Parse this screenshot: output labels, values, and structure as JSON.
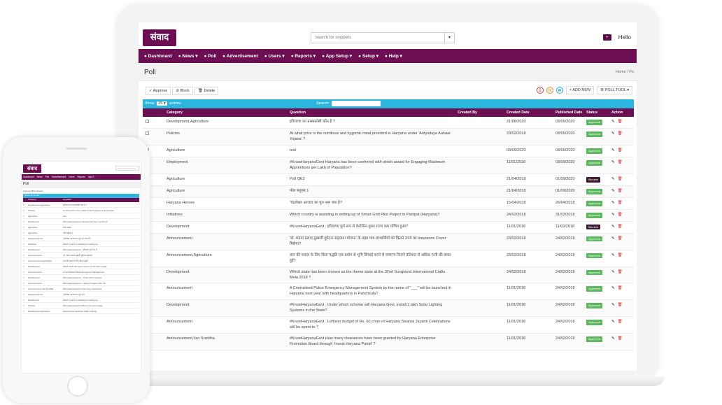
{
  "app": {
    "logo_text": "संवाद",
    "hello_label": "Hello",
    "plus_icon": "+"
  },
  "search": {
    "placeholder": "Search for snippets",
    "button": "▾"
  },
  "nav": [
    {
      "label": "Dashboard",
      "icon": "home-icon"
    },
    {
      "label": "News",
      "icon": "newspaper-icon"
    },
    {
      "label": "Poll",
      "icon": "question-icon"
    },
    {
      "label": "Advertisement",
      "icon": "image-icon"
    },
    {
      "label": "Users",
      "icon": "users-icon"
    },
    {
      "label": "Reports",
      "icon": "file-icon"
    },
    {
      "label": "App Setup",
      "icon": "gear-icon"
    },
    {
      "label": "Setup",
      "icon": "gear-icon"
    },
    {
      "label": "Help",
      "icon": "help-icon"
    }
  ],
  "page": {
    "title": "Poll",
    "breadcrumb_home": "Home",
    "breadcrumb_current": "Po"
  },
  "toolbar": {
    "approve": "Approve",
    "block": "Block",
    "delete": "Delete",
    "add_new": "+ ADD NEW",
    "poll_tool": "POLL TOOL"
  },
  "filter": {
    "show_label": "Show",
    "entries_value": "25",
    "entries_label": "entries",
    "search_label": "Search:"
  },
  "table": {
    "headers": [
      "",
      "Category",
      "Question",
      "Created By",
      "Created Date",
      "Published Date",
      "Status",
      "Action"
    ],
    "rows": [
      {
        "category": "Development,Agriculture",
        "question": "हरियाणा का प्रथमकोष्ठी कौन है ?",
        "created_by": "",
        "created": "21/08/2020",
        "published": "03/09/2020",
        "status": "Approved"
      },
      {
        "category": "Policies",
        "question": "At what price is the nutritious and hygienic meal provided in Haryana under 'Antyodaya Aahaar Yojana' ?",
        "created_by": "",
        "created": "23/02/2018",
        "published": "03/09/2020",
        "status": "Approved"
      },
      {
        "category": "Agriculture",
        "question": "test",
        "created_by": "",
        "created": "03/09/2020",
        "published": "03/09/2020",
        "status": "Approved"
      },
      {
        "category": "Employment",
        "question": "#KnowHaryanaGovt Haryana has been conferred with which award for Engaging Maximum Apprentices per Lakh of Population?",
        "created_by": "",
        "created": "11/01/2018",
        "published": "03/09/2020",
        "status": "Approved"
      },
      {
        "category": "Agriculture",
        "question": "Poll QE2",
        "created_by": "",
        "created": "21/04/2018",
        "published": "01/09/2020",
        "status": "Blocked"
      },
      {
        "category": "Agriculture",
        "question": "पोल क्यूएस 1",
        "created_by": "",
        "created": "21/04/2018",
        "published": "01/09/2020",
        "status": "Approved"
      },
      {
        "category": "Haryana Heroes",
        "question": "'चंद्रशेखर आजाद का पूरा नाम क्या है?",
        "created_by": "",
        "created": "15/04/2018",
        "published": "26/04/2018",
        "status": "Approved"
      },
      {
        "category": "Initiatives",
        "question": "Which country is assisting in setting up of Smart Grid Pilot Project in Panipat (Haryana)?",
        "created_by": "",
        "created": "24/02/2018",
        "published": "31/03/2018",
        "status": "Approved"
      },
      {
        "category": "Development",
        "question": "#KnowHaryanaGovt : हरियाणा पूर्ण रूप से केरोसिन मुक्त राज्य कब घोषित हुआ?",
        "created_by": "",
        "created": "11/01/2018",
        "published": "11/03/2018",
        "status": "Blocked"
      },
      {
        "category": "Announcement",
        "question": "'डॉ. श्यामा प्रसाद मुखर्जी दुर्घटना सहायता योजना' के तहत पात्र लाभार्थियों को कितने रुपये का Insurance Cover मिलेगा?",
        "created_by": "",
        "created": "23/02/2018",
        "published": "24/02/2018",
        "status": "Approved"
      },
      {
        "category": "Announcement,Agriculture",
        "question": "धान की फसल के लिए किस पद्धति एक प्रयोग से भूमि सिंचाई करने से सामान्य कितने प्रतिशत से अधिक पानी की बचत हुई?",
        "created_by": "",
        "created": "23/02/2018",
        "published": "24/02/2018",
        "status": "Approved"
      },
      {
        "category": "Development",
        "question": "Which state has been chosen as the theme state at the 32nd Surajkund International Crafts Mela 2018 ?",
        "created_by": "",
        "created": "24/02/2018",
        "published": "24/02/2018",
        "status": "Approved"
      },
      {
        "category": "Announcement",
        "question": "A Centralised Police Emergency Management System by the name of \"___\" will be launched in Haryana next year with headquarters in Panchkula?",
        "created_by": "",
        "created": "11/01/2018",
        "published": "24/02/2018",
        "status": "Approved"
      },
      {
        "category": "Development",
        "question": "#KnowHaryanaGovt : Under which scheme will Haryana Govt. install 1 lakh Solar Lighting Systems in the State?",
        "created_by": "",
        "created": "11/01/2018",
        "published": "24/02/2018",
        "status": "Approved"
      },
      {
        "category": "Announcement",
        "question": "#KnowHaryanaGovt : Leftover budget of Rs. 60 crore of Haryana Swarna Jayanti Celebrations will be spent to ?",
        "created_by": "",
        "created": "11/01/2018",
        "published": "24/02/2018",
        "status": "Approved"
      },
      {
        "category": "Announcement,Jan Suvidha",
        "question": "#KnowHaryanaGovt How many clearances have been granted by Haryana Enterprise Promotion Board through 'Invest Haryana Portal' ?",
        "created_by": "",
        "created": "11/01/2018",
        "published": "24/02/2018",
        "status": "Approved"
      }
    ]
  },
  "phone": {
    "logo_text": "संवाद",
    "search_placeholder": "Search for snippets",
    "nav": [
      "Dashboard",
      "News",
      "Poll",
      "Advertisement",
      "Users",
      "Reports",
      "App S"
    ],
    "title": "Poll",
    "toolbar": "Approve  Block  Delete",
    "filter": "Show 25 entries",
    "headers": [
      "Category",
      "Question"
    ],
    "rows": [
      {
        "cat": "Development,Agriculture",
        "q": "हरियाणा का प्रथमकोष्ठी कौन है ?"
      },
      {
        "cat": "Policies",
        "q": "At what price is the nutritious and hygienic meal provided"
      },
      {
        "cat": "Agriculture",
        "q": "test"
      },
      {
        "cat": "Employment",
        "q": "#KnowHaryanaGovt Haryana has been conferred"
      },
      {
        "cat": "Agriculture",
        "q": "Poll QE2"
      },
      {
        "cat": "Agriculture",
        "q": "पोल क्यूएस 1"
      },
      {
        "cat": "Haryana Heroes",
        "q": "'चंद्रशेखर आजाद का पूरा नाम क्या है?"
      },
      {
        "cat": "Initiatives",
        "q": "Which country is assisting in setting up"
      },
      {
        "cat": "Development",
        "q": "#KnowHaryanaGovt : हरियाणा पूर्ण रूप से"
      },
      {
        "cat": "Announcement",
        "q": "'डॉ. श्यामा प्रसाद मुखर्जी दुर्घटना सहायता'"
      },
      {
        "cat": "Announcement,Agriculture",
        "q": "धान की फसल के लिए किस पद्धति"
      },
      {
        "cat": "Development",
        "q": "Which state has been chosen as the theme state"
      },
      {
        "cat": "Announcement",
        "q": "A Centralised Police Emergency Management"
      },
      {
        "cat": "Development",
        "q": "#KnowHaryanaGovt : Under which scheme"
      },
      {
        "cat": "Announcement",
        "q": "#KnowHaryanaGovt : Leftover budget of Rs. 60"
      },
      {
        "cat": "Announcement,Jan Suvidha",
        "q": "#KnowHaryanaGovt How many clearances"
      },
      {
        "cat": "Haryana Heroes",
        "q": "'चंद्रशेखर आजाद का पूरा नाम'"
      },
      {
        "cat": "Employment",
        "q": "Which country is assisting in setting up"
      },
      {
        "cat": "Policies",
        "q": "#KnowHaryanaGovt What is the percentage"
      },
      {
        "cat": "Development,Agriculture",
        "q": "Haryana has launched which scheme"
      }
    ]
  },
  "colors": {
    "brand": "#6b0f52",
    "filter_bar": "#2cb6de",
    "approved": "#5cb85c",
    "blocked": "#3a1a2e",
    "delete": "#d9262b"
  }
}
